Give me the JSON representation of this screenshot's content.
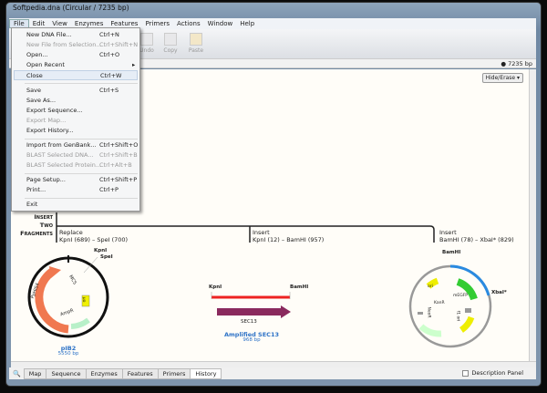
{
  "window": {
    "title": "Softpedia.dna  (Circular / 7235 bp)"
  },
  "menubar": [
    "File",
    "Edit",
    "View",
    "Enzymes",
    "Features",
    "Primers",
    "Actions",
    "Window",
    "Help"
  ],
  "file_menu": [
    {
      "label": "New DNA File...",
      "shortcut": "Ctrl+N",
      "disabled": false
    },
    {
      "label": "New File from Selection...",
      "shortcut": "Ctrl+Shift+N",
      "disabled": true
    },
    {
      "label": "Open...",
      "shortcut": "Ctrl+O",
      "disabled": false
    },
    {
      "label": "Open Recent",
      "shortcut": "▸",
      "disabled": false
    },
    {
      "label": "Close",
      "shortcut": "Ctrl+W",
      "disabled": false
    },
    {
      "label": "Save",
      "shortcut": "Ctrl+S",
      "disabled": false
    },
    {
      "label": "Save As...",
      "shortcut": "",
      "disabled": false
    },
    {
      "label": "Export Sequence...",
      "shortcut": "",
      "disabled": false
    },
    {
      "label": "Export Map...",
      "shortcut": "",
      "disabled": true
    },
    {
      "label": "Export History...",
      "shortcut": "",
      "disabled": false
    },
    {
      "label": "Import from GenBank...",
      "shortcut": "Ctrl+Shift+O",
      "disabled": false
    },
    {
      "label": "BLAST Selected DNA...",
      "shortcut": "Ctrl+Shift+B",
      "disabled": true
    },
    {
      "label": "BLAST Selected Protein...",
      "shortcut": "Ctrl+Alt+B",
      "disabled": true
    },
    {
      "label": "Page Setup...",
      "shortcut": "Ctrl+Shift+P",
      "disabled": false
    },
    {
      "label": "Print...",
      "shortcut": "Ctrl+P",
      "disabled": false
    },
    {
      "label": "Exit",
      "shortcut": "",
      "disabled": false
    }
  ],
  "toolbar": {
    "undo": "Undo",
    "copy": "Copy",
    "paste": "Paste"
  },
  "status": {
    "length": "7235 bp"
  },
  "hide_erase": "Hide/Erase ▾",
  "history": {
    "heading": [
      "Insert",
      "Two",
      "Fragments"
    ],
    "steps": [
      {
        "action": "Replace",
        "detail": "KpnI (689)  –  SpeI (700)"
      },
      {
        "action": "Insert",
        "detail": "KpnI (12)  –  BamHI (957)"
      },
      {
        "action": "Insert",
        "detail": "BamHI (78)  –  XbaI* (829)"
      }
    ],
    "plasmid1": {
      "name": "pIB2",
      "size": "5550 bp",
      "sites": [
        "KpnI",
        "SpeI"
      ],
      "features": [
        "PpHIS4",
        "MCS",
        "ori",
        "AmpR"
      ]
    },
    "fragment": {
      "name": "Amplified SEC13",
      "size": "968 bp",
      "sites": [
        "KpnI",
        "BamHI"
      ],
      "feature": "SEC13"
    },
    "plasmid2": {
      "sites": [
        "BamHI",
        "XbaI*"
      ],
      "features": [
        "ori",
        "mEGFP",
        "KanR",
        "NeoR",
        "f1 ori"
      ]
    }
  },
  "tabs": [
    "Map",
    "Sequence",
    "Enzymes",
    "Features",
    "Primers",
    "History"
  ],
  "selected_tab": "History",
  "description_panel": "Description Panel"
}
